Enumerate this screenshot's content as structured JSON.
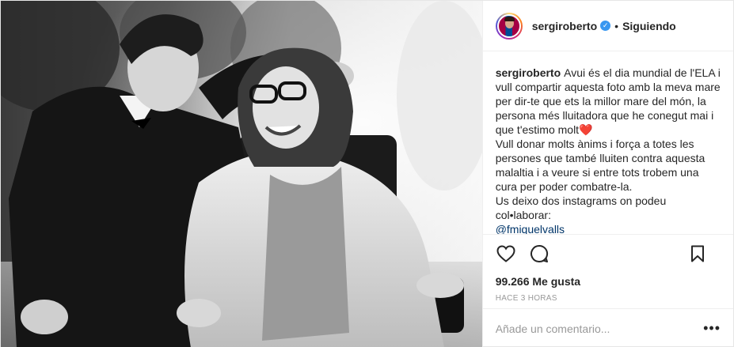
{
  "photo": {
    "alt": "",
    "style": "black-and-white"
  },
  "header": {
    "username": "sergiroberto",
    "verified_icon": "check-badge-icon",
    "separator": "•",
    "follow_status": "Siguiendo"
  },
  "caption": {
    "username": "sergiroberto",
    "paragraph1": "Avui és el dia mundial de l'ELA i vull compartir aquesta foto amb la meva mare per dir-te que ets la millor mare del món, la persona més lluitadora que he conegut mai i que t'estimo molt",
    "heart": "❤️",
    "paragraph2": "Vull donar molts ànims i força a totes les persones que també lluiten contra aquesta malaltia i a veure si entre tots trobem una cura per poder combatre-la.",
    "paragraph3": "Us deixo dos instagrams on podeu col•laborar:",
    "mention": "@fmiquelvalls"
  },
  "actions": {
    "like_icon": "heart-outline-icon",
    "comment_icon": "speech-bubble-icon",
    "save_icon": "bookmark-icon"
  },
  "likes": {
    "text": "99.266 Me gusta"
  },
  "time": {
    "text": "HACE 3 HORAS"
  },
  "comment": {
    "placeholder": "Añade un comentario...",
    "more_icon": "ellipsis-icon",
    "more_label": "•••"
  },
  "colors": {
    "accent": "#3897f0",
    "border": "#efefef",
    "text": "#262626",
    "muted": "#999999",
    "mention": "#003569"
  }
}
